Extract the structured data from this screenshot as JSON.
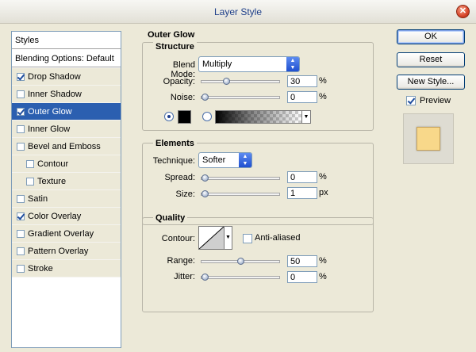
{
  "window": {
    "title": "Layer Style"
  },
  "styles_panel": {
    "header": "Styles",
    "blending_default": "Blending Options: Default",
    "items": [
      {
        "label": "Drop Shadow",
        "checked": true
      },
      {
        "label": "Inner Shadow",
        "checked": false
      },
      {
        "label": "Outer Glow",
        "checked": true,
        "selected": true
      },
      {
        "label": "Inner Glow",
        "checked": false
      },
      {
        "label": "Bevel and Emboss",
        "checked": false
      },
      {
        "label": "Contour",
        "checked": false,
        "sub": true
      },
      {
        "label": "Texture",
        "checked": false,
        "sub": true
      },
      {
        "label": "Satin",
        "checked": false
      },
      {
        "label": "Color Overlay",
        "checked": true
      },
      {
        "label": "Gradient Overlay",
        "checked": false
      },
      {
        "label": "Pattern Overlay",
        "checked": false
      },
      {
        "label": "Stroke",
        "checked": false
      }
    ]
  },
  "outer_glow": {
    "title": "Outer Glow",
    "structure": {
      "label": "Structure",
      "blend_mode_label": "Blend Mode:",
      "blend_mode_value": "Multiply",
      "opacity_label": "Opacity:",
      "opacity_value": "30",
      "opacity_level": 0.3,
      "opacity_unit": "%",
      "noise_label": "Noise:",
      "noise_value": "0",
      "noise_level": 0,
      "noise_unit": "%",
      "color_mode": "solid",
      "glow_color": "#000000"
    },
    "elements": {
      "label": "Elements",
      "technique_label": "Technique:",
      "technique_value": "Softer",
      "spread_label": "Spread:",
      "spread_value": "0",
      "spread_level": 0,
      "spread_unit": "%",
      "size_label": "Size:",
      "size_value": "1",
      "size_level": 0.004,
      "size_unit": "px"
    },
    "quality": {
      "label": "Quality",
      "contour_label": "Contour:",
      "anti_aliased_label": "Anti-aliased",
      "anti_aliased_checked": false,
      "range_label": "Range:",
      "range_value": "50",
      "range_level": 0.5,
      "range_unit": "%",
      "jitter_label": "Jitter:",
      "jitter_value": "0",
      "jitter_level": 0,
      "jitter_unit": "%"
    }
  },
  "buttons": {
    "ok": "OK",
    "reset": "Reset",
    "new_style": "New Style...",
    "preview_label": "Preview",
    "preview_checked": true,
    "preview_color": "#f8d88a"
  }
}
